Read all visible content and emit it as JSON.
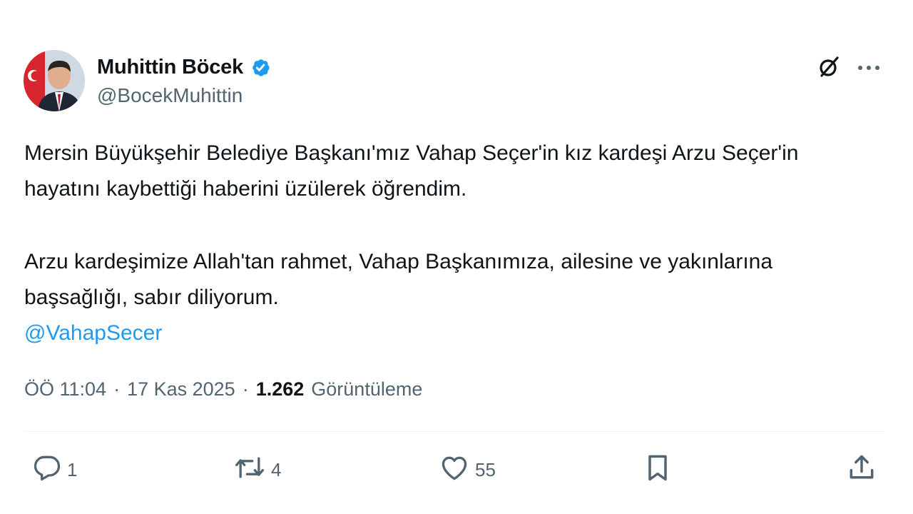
{
  "author": {
    "display_name": "Muhittin Böcek",
    "handle": "@BocekMuhittin",
    "verified_icon": "verified-badge-icon",
    "avatar_icon": "profile-avatar"
  },
  "header_actions": {
    "grok_icon": "grok-icon",
    "more_icon": "more-options-icon"
  },
  "tweet": {
    "paragraph_1": "Mersin Büyükşehir Belediye Başkanı'mız Vahap Seçer'in kız kardeşi Arzu Seçer'in hayatını kaybettiği haberini üzülerek öğrendim.",
    "paragraph_2": "Arzu kardeşimize Allah'tan rahmet, Vahap Başkanımıza, ailesine ve yakınlarına başsağlığı, sabır diliyorum.",
    "mention": "@VahapSecer"
  },
  "meta": {
    "time": "ÖÖ 11:04",
    "separator": "·",
    "date": "17 Kas 2025",
    "views_count": "1.262",
    "views_label": "Görüntüleme"
  },
  "actions": {
    "reply_count": "1",
    "retweet_count": "4",
    "like_count": "55"
  },
  "colors": {
    "accent": "#1d9bf0",
    "text": "#0f1419",
    "secondary": "#536471",
    "divider": "#eff3f4"
  }
}
